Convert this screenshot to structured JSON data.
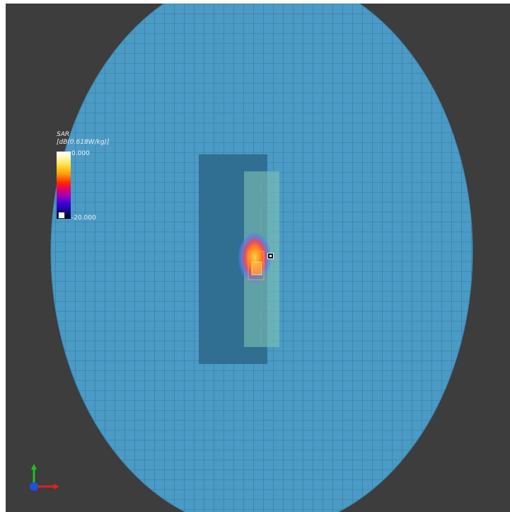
{
  "legend": {
    "title": "SAR",
    "unit": "[dB(0.618W/kg)]",
    "max_label": "0.000",
    "min_label": "-20.000"
  },
  "colors": {
    "background": "#3d3d3d",
    "phantom": "#4a9bc6",
    "grid_line": "#31566d",
    "substrate": "#2f6a8c",
    "device": "#7fc3b4",
    "hotspot_outer": "#5b7ee8",
    "hotspot_mid": "#ff8a1a",
    "hotspot_core": "#ffd24a"
  },
  "axes_triad": {
    "x_color": "#e02020",
    "y_color": "#20c020",
    "z_color": "#2050e0"
  },
  "icons": {
    "probe": "probe-marker-icon",
    "triad": "axis-triad-icon"
  }
}
